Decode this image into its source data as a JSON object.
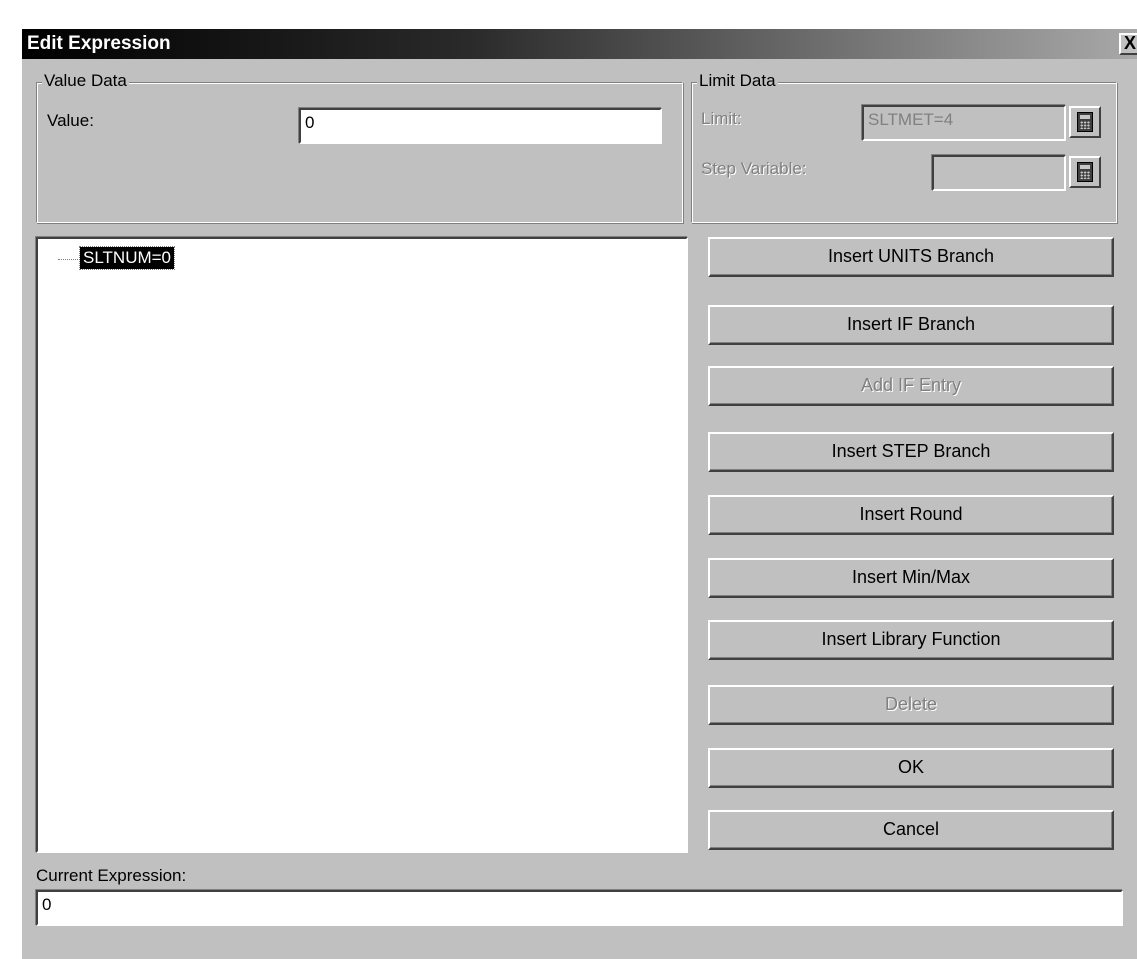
{
  "window": {
    "title": "Edit Expression",
    "close_label": "X"
  },
  "value_data": {
    "legend": "Value Data",
    "value_label": "Value:",
    "value": "0"
  },
  "limit_data": {
    "legend": "Limit Data",
    "limit_label": "Limit:",
    "limit_value": "SLTMET=4",
    "step_variable_label": "Step Variable:",
    "step_variable_value": "",
    "enabled": false
  },
  "tree": {
    "nodes": [
      {
        "label": "SLTNUM=0",
        "selected": true
      }
    ]
  },
  "buttons": [
    {
      "label": "Insert UNITS Branch",
      "enabled": true
    },
    {
      "label": "Insert IF Branch",
      "enabled": true
    },
    {
      "label": "Add IF Entry",
      "enabled": false
    },
    {
      "label": "Insert STEP Branch",
      "enabled": true
    },
    {
      "label": "Insert Round",
      "enabled": true
    },
    {
      "label": "Insert Min/Max",
      "enabled": true
    },
    {
      "label": "Insert Library Function",
      "enabled": true
    },
    {
      "label": "Delete",
      "enabled": false
    },
    {
      "label": "OK",
      "enabled": true
    },
    {
      "label": "Cancel",
      "enabled": true
    }
  ],
  "current_expression": {
    "label": "Current Expression:",
    "value": "0"
  },
  "colors": {
    "dialog_face": "#c0c0c0",
    "selection_bg": "#000000",
    "disabled_text": "#808080"
  },
  "icons": {
    "calculator": "calculator-icon"
  }
}
